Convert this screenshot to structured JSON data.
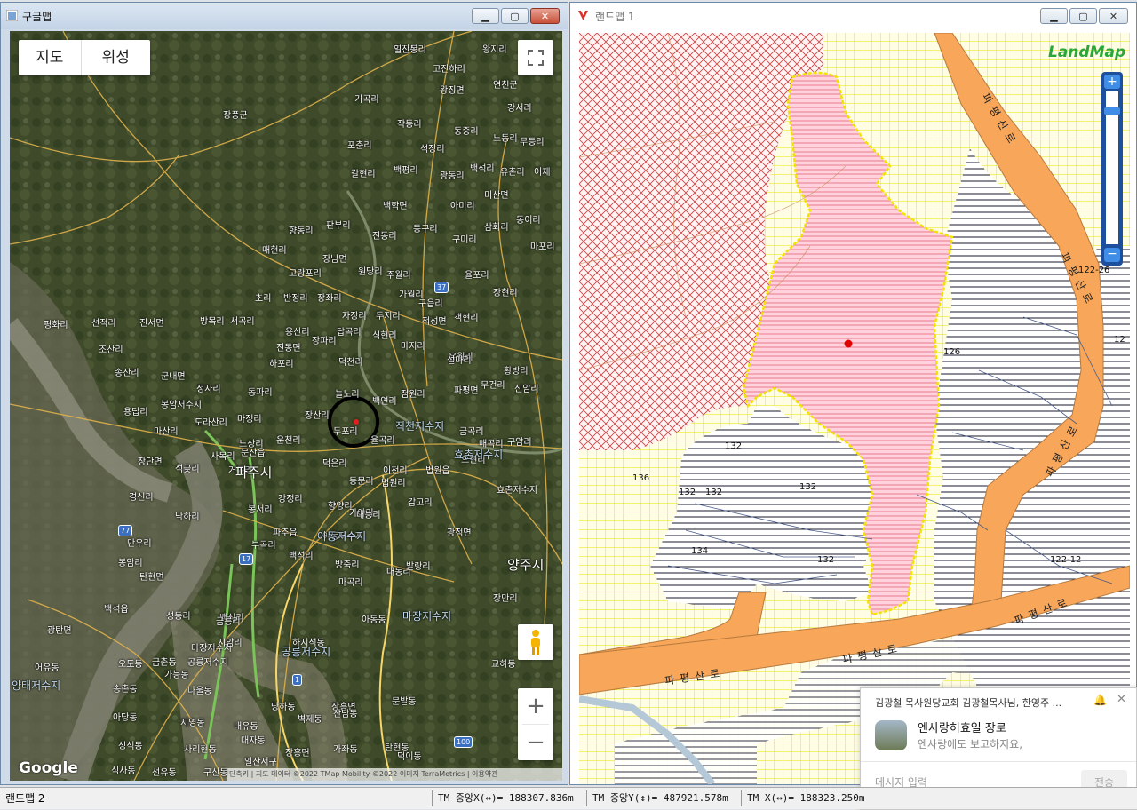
{
  "google_window": {
    "title": "구글맵",
    "map_type": {
      "map": "지도",
      "satellite": "위성"
    },
    "attribution": "단축키 | 지도 데이터 ©2022 TMap Mobility ©2022 이미지 TerraMetrics | 이용약관",
    "logo": "Google",
    "zoom_in": "+",
    "zoom_out": "−",
    "labels_small": [
      "고잔상리",
      "왕지리",
      "고잔하리",
      "왕징면",
      "연천군",
      "기곡리",
      "강서리",
      "작동리",
      "동중리",
      "포춘리",
      "석장리",
      "노동리",
      "무등리",
      "갈현리",
      "백평리",
      "광동리",
      "백석리",
      "유촌리",
      "이재",
      "장풍군",
      "백학면",
      "아미리",
      "미산면",
      "향동리",
      "판부리",
      "전동리",
      "동구리",
      "삼화리",
      "구미리",
      "동이리",
      "매현리",
      "장남면",
      "원당리",
      "주월리",
      "고랑포리",
      "율포리",
      "마포리",
      "초리",
      "반정리",
      "장좌리",
      "가월리",
      "장현리",
      "평화리",
      "선적리",
      "진서면",
      "방목리",
      "서곡리",
      "자장리",
      "두지리",
      "구읍리",
      "적성면",
      "객현리",
      "조산리",
      "용산리",
      "답곡리",
      "식현리",
      "마지리",
      "유월리",
      "진동면",
      "장파리",
      "송산리",
      "군내면",
      "하포리",
      "덕천리",
      "설마리",
      "황방리",
      "정자리",
      "동파리",
      "늘노리",
      "점원리",
      "파평면",
      "무건리",
      "신암리",
      "봉암저수지",
      "백연리",
      "용답리",
      "도라산리",
      "마정리",
      "장산리",
      "두포리",
      "마산리",
      "노상리",
      "운천리",
      "율곡리",
      "금곡리",
      "매곡리",
      "구암리",
      "사목리",
      "문산읍",
      "장단면",
      "덕은리",
      "이천리",
      "법원읍",
      "오현리",
      "효촌저수지",
      "석곶리",
      "거곡리",
      "동문리",
      "법원리",
      "감고리",
      "경신리",
      "강정리",
      "향양리",
      "가야리",
      "낙하리",
      "대능리",
      "광적면",
      "만우리",
      "봉서리",
      "파주읍",
      "아동저수지",
      "대동리",
      "봉암리",
      "부곡리",
      "백석리",
      "발랑리",
      "탄현면",
      "방축리",
      "백석읍",
      "성동리",
      "마곡리",
      "장만리",
      "백석리",
      "금릉리",
      "아동동",
      "광탄면",
      "마장저수지",
      "시암리",
      "하지석동",
      "금촌동",
      "공릉저수지",
      "어유동",
      "오도동",
      "교하동",
      "가능동",
      "송촌동",
      "나울동",
      "당하동",
      "장흥면",
      "문발동",
      "아당동",
      "지영동",
      "내유동",
      "벽제동",
      "산남동",
      "탄현동",
      "성석동",
      "사리현동",
      "대자동",
      "장흥면",
      "가좌동",
      "덕이동",
      "식사동",
      "선유동",
      "구산동",
      "일산서구",
      "일산동"
    ],
    "labels_big": [
      "파주시",
      "양주시"
    ],
    "route_badges": [
      "37",
      "17",
      "77",
      "1",
      "100"
    ],
    "labels_lake": [
      "직천저수지",
      "효촌저수지",
      "아동저수지",
      "마장저수지",
      "공릉저수지",
      "양태저수지"
    ]
  },
  "landmap_window": {
    "title": "랜드맵 1",
    "logo": "LandMap",
    "parcel_numbers": [
      "126",
      "132",
      "136",
      "132",
      "132",
      "132",
      "134",
      "132",
      "122-26",
      "122-12",
      "12"
    ],
    "road_names": [
      "파평산로",
      "파평산로",
      "파평산로",
      "파평산로",
      "파평산로",
      "파평산로"
    ]
  },
  "chat_popup": {
    "header": "김광철 목사원당교회 김광철목사님, 한영주 ...",
    "title": "엔사랑허효일 장로",
    "preview": "엔사랑에도 보고하지요,",
    "input_placeholder": "메시지 입력",
    "send": "전송"
  },
  "statusbar": {
    "left": "랜드맵 2",
    "tm_x": "TM 중앙X(↔)= 188307.836m",
    "tm_y": "TM 중앙Y(↕)= 487921.578m",
    "tm_x2": "TM X(↔)= 188323.250m"
  }
}
